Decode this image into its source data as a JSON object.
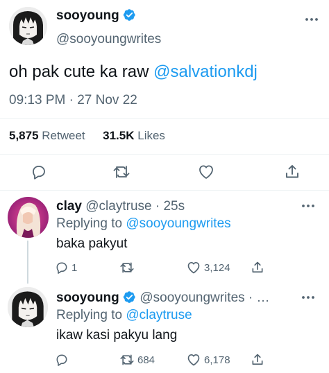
{
  "main_tweet": {
    "display_name": "sooyoung",
    "handle": "@sooyoungwrites",
    "text_prefix": "oh pak cute ka raw ",
    "mention": "@salvationkdj",
    "timestamp": "09:13 PM · 27 Nov 22",
    "retweet_count": "5,875",
    "retweet_label": "Retweet",
    "like_count": "31.5K",
    "like_label": "Likes",
    "actions": [
      "reply-icon",
      "retweet-icon",
      "like-icon",
      "share-icon"
    ]
  },
  "replies": [
    {
      "display_name": "clay",
      "handle": "@claytruse",
      "time": "· 25s",
      "replying_prefix": "Replying to ",
      "replying_to": "@sooyoungwrites",
      "text": "baka pakyut",
      "reply_count": "1",
      "retweet_count": "",
      "like_count": "3,124"
    },
    {
      "display_name": "sooyoung",
      "handle": "@sooyoungwrites · …",
      "replying_prefix": "Replying to ",
      "replying_to": "@claytruse",
      "text": "ikaw kasi pakyu lang",
      "reply_count": "",
      "retweet_count": "684",
      "like_count": "6,178"
    }
  ],
  "colors": {
    "accent": "#1d9bf0",
    "muted": "#536471",
    "divider": "#eff3f4"
  }
}
